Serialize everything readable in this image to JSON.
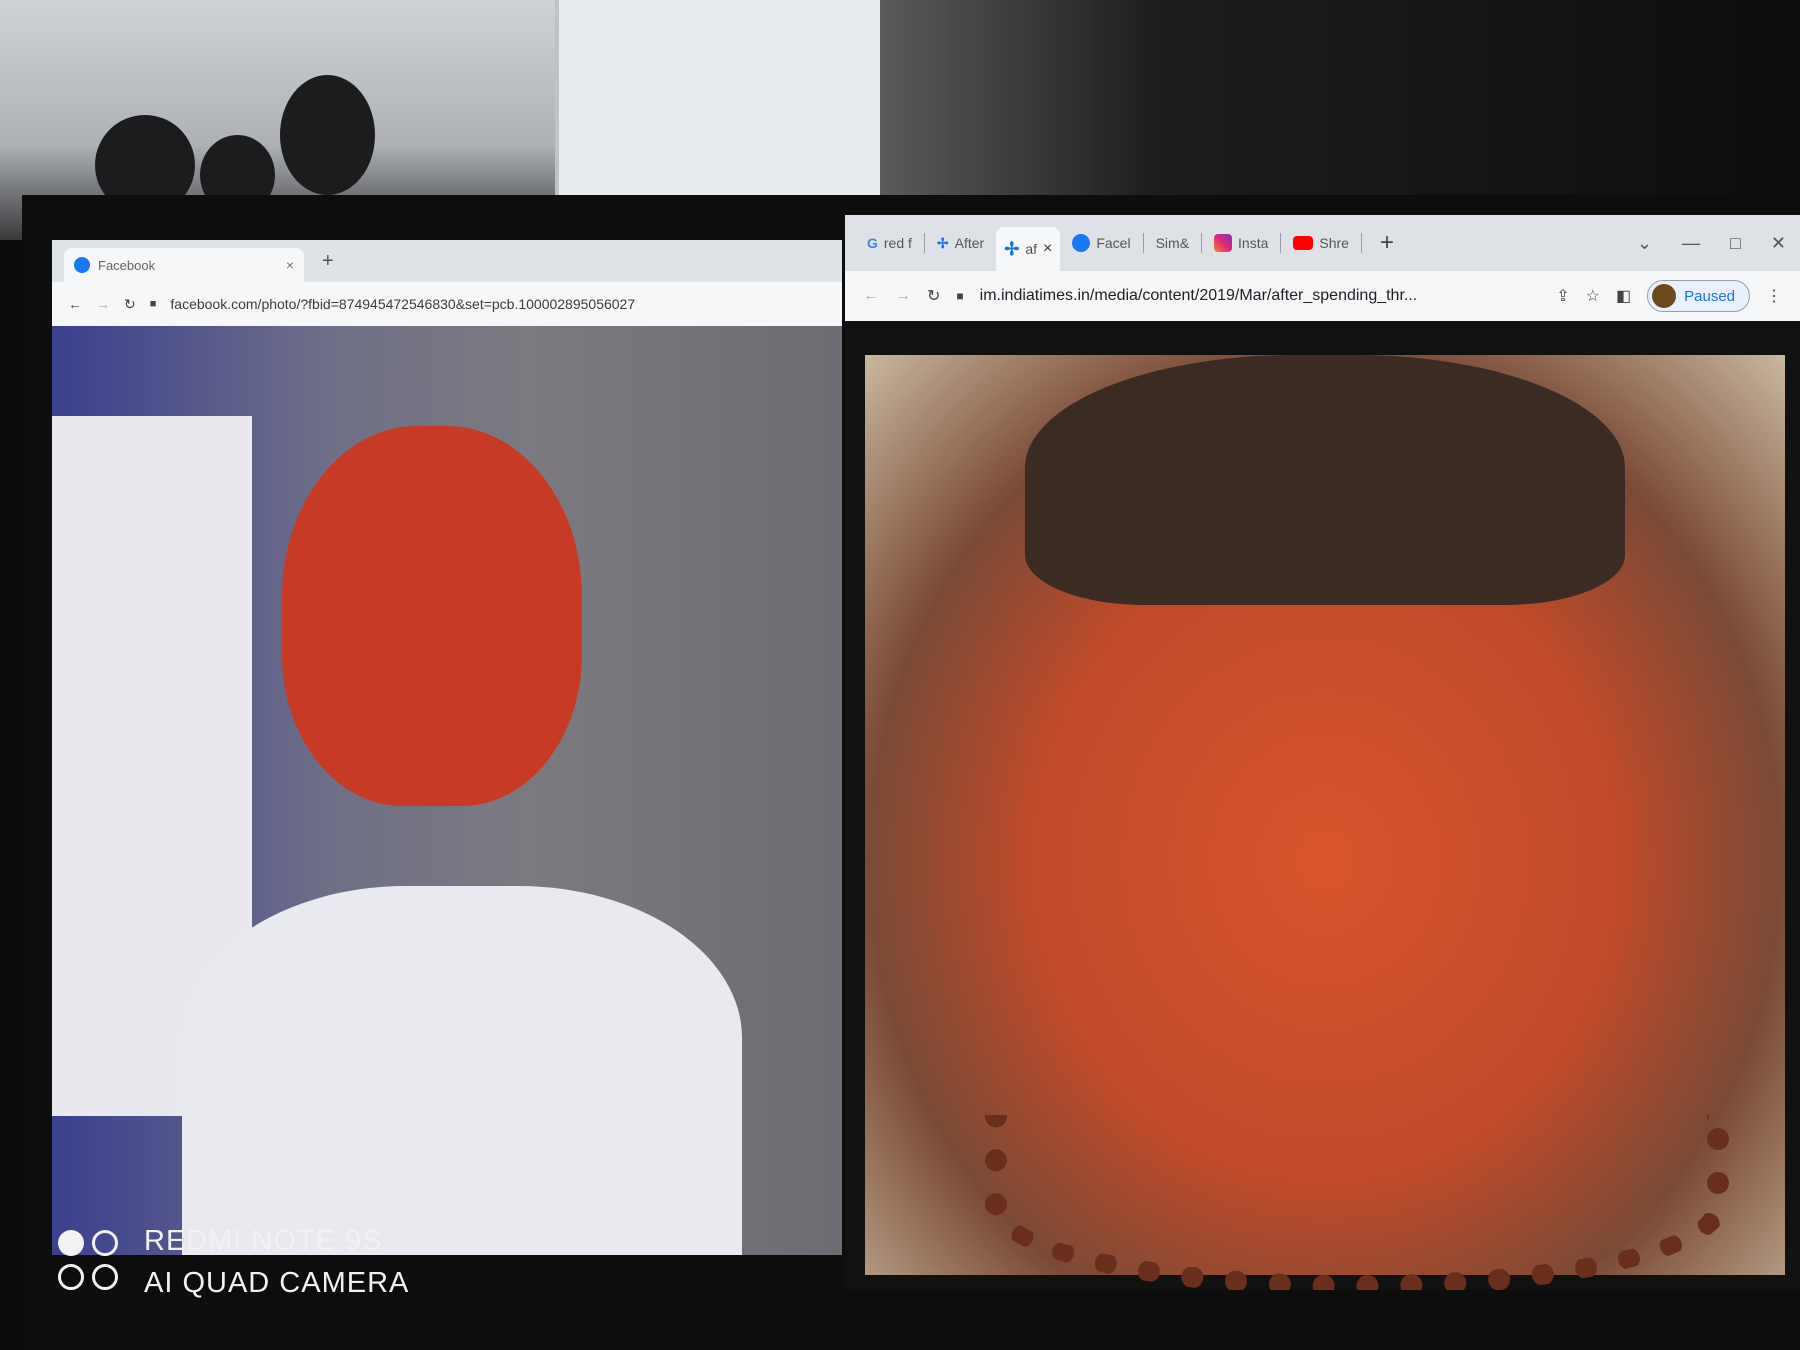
{
  "left_browser": {
    "tab_title": "Facebook",
    "url": "facebook.com/photo/?fbid=874945472546830&set=pcb.100002895056027",
    "tab_close": "×",
    "new_tab": "+"
  },
  "right_browser": {
    "tabs": [
      {
        "label": "red f",
        "icon": "google-icon"
      },
      {
        "label": "After",
        "icon": "indiatimes-icon"
      },
      {
        "label": "af",
        "icon": "indiatimes-icon",
        "active": true
      },
      {
        "label": "Facel",
        "icon": "facebook-icon"
      },
      {
        "label": "Sim&",
        "icon": "blank-icon"
      },
      {
        "label": "Insta",
        "icon": "instagram-icon"
      },
      {
        "label": "Shre",
        "icon": "youtube-icon"
      }
    ],
    "active_tab_close": "×",
    "new_tab": "+",
    "url": "im.indiatimes.in/media/content/2019/Mar/after_spending_thr...",
    "profile_status": "Paused"
  },
  "watermark": {
    "line1": "REDMI NOTE 9S",
    "line2": "AI QUAD CAMERA"
  },
  "colors": {
    "chrome_tabbar": "#dee2e6",
    "chrome_toolbar": "#f6f7f8",
    "face_paint": "#d9552c",
    "facebook_blue": "#1877f2"
  }
}
